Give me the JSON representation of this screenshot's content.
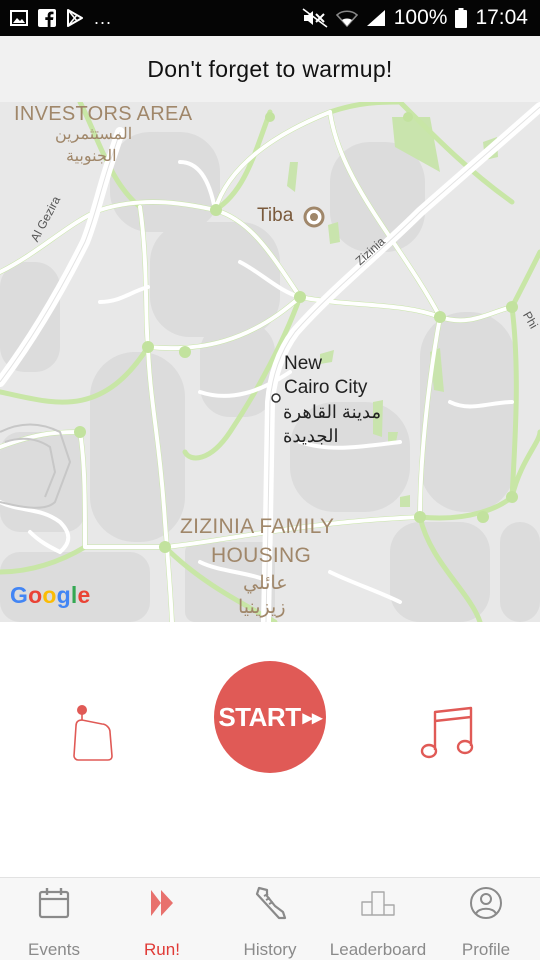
{
  "status_bar": {
    "left_icons": [
      "image-icon",
      "facebook-icon",
      "play-store-icon"
    ],
    "more": "...",
    "battery": "100%",
    "time": "17:04"
  },
  "banner": {
    "text": "Don't forget to warmup!"
  },
  "map": {
    "labels": {
      "investors_area": "INVESTORS AREA",
      "investors_area_ar_1": "المستثمرين",
      "investors_area_ar_2": "الجنوبية",
      "al_gezira": "Al Gezira",
      "tiba": "Tiba",
      "zizinia_road": "Zizinia",
      "new_cairo_1": "New",
      "new_cairo_2": "Cairo City",
      "new_cairo_ar_1": "مدينة القاهرة",
      "new_cairo_ar_2": "الجديدة",
      "zizinia_family_1": "ZIZINIA FAMILY",
      "zizinia_family_2": "HOUSING",
      "zizinia_family_ar_1": "عائلي",
      "zizinia_family_ar_2": "زيزينيا",
      "phi": "Phi"
    },
    "google": [
      "G",
      "o",
      "o",
      "g",
      "l",
      "e"
    ],
    "google_colors": [
      "#4285F4",
      "#EA4335",
      "#FBBC05",
      "#4285F4",
      "#34A853",
      "#EA4335"
    ]
  },
  "controls": {
    "start_label": "START",
    "start_arrows": "▸▸",
    "accent": "#e05a56"
  },
  "nav": {
    "items": [
      {
        "label": "Events",
        "icon": "calendar-icon"
      },
      {
        "label": "Run!",
        "icon": "run-arrows-icon",
        "active": true
      },
      {
        "label": "History",
        "icon": "shoe-icon"
      },
      {
        "label": "Leaderboard",
        "icon": "podium-icon"
      },
      {
        "label": "Profile",
        "icon": "profile-icon"
      }
    ]
  }
}
